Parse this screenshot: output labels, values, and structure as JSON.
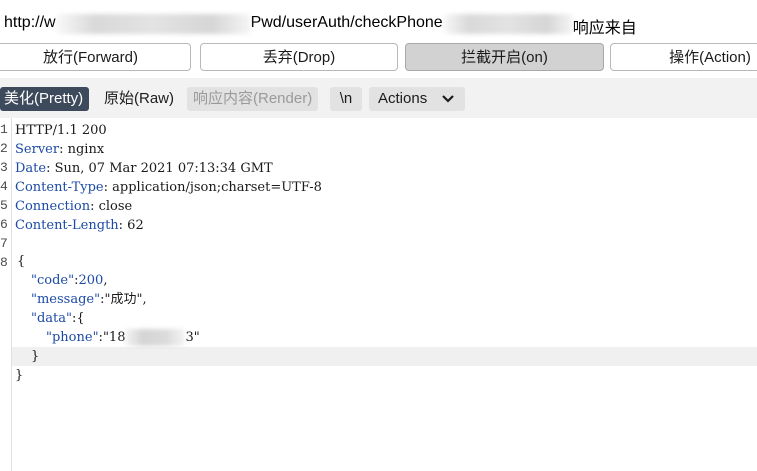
{
  "url": {
    "prefix": "http://w",
    "middle": "Pwd/userAuth/checkPhone",
    "suffix": "响应来自"
  },
  "top_buttons": {
    "forward": "放行(Forward)",
    "drop": "丢弃(Drop)",
    "intercept": "拦截开启(on)",
    "action": "操作(Action)"
  },
  "toolbar": {
    "pretty": "美化(Pretty)",
    "raw": "原始(Raw)",
    "render": "响应内容(Render)",
    "newline": "\\n",
    "actions": "Actions"
  },
  "response": {
    "line_numbers": [
      "1",
      "2",
      "3",
      "4",
      "5",
      "6",
      "7",
      "8"
    ],
    "status_line": "HTTP/1.1 200",
    "headers": [
      {
        "key": "Server",
        "value": ": nginx"
      },
      {
        "key": "Date",
        "value": ": Sun, 07 Mar 2021 07:13:34 GMT"
      },
      {
        "key": "Content-Type",
        "value": ": application/json;charset=UTF-8"
      },
      {
        "key": "Connection",
        "value": ": close"
      },
      {
        "key": "Content-Length",
        "value": ": 62"
      }
    ],
    "body": {
      "open": "{",
      "code_key": "\"code\"",
      "code_val": "200",
      "message_key": "\"message\"",
      "message_val": "\"成功\"",
      "data_key": "\"data\"",
      "phone_key": "\"phone\"",
      "phone_start": "\"18",
      "phone_end": "3\"",
      "inner_close": "}",
      "outer_close": "}"
    }
  }
}
